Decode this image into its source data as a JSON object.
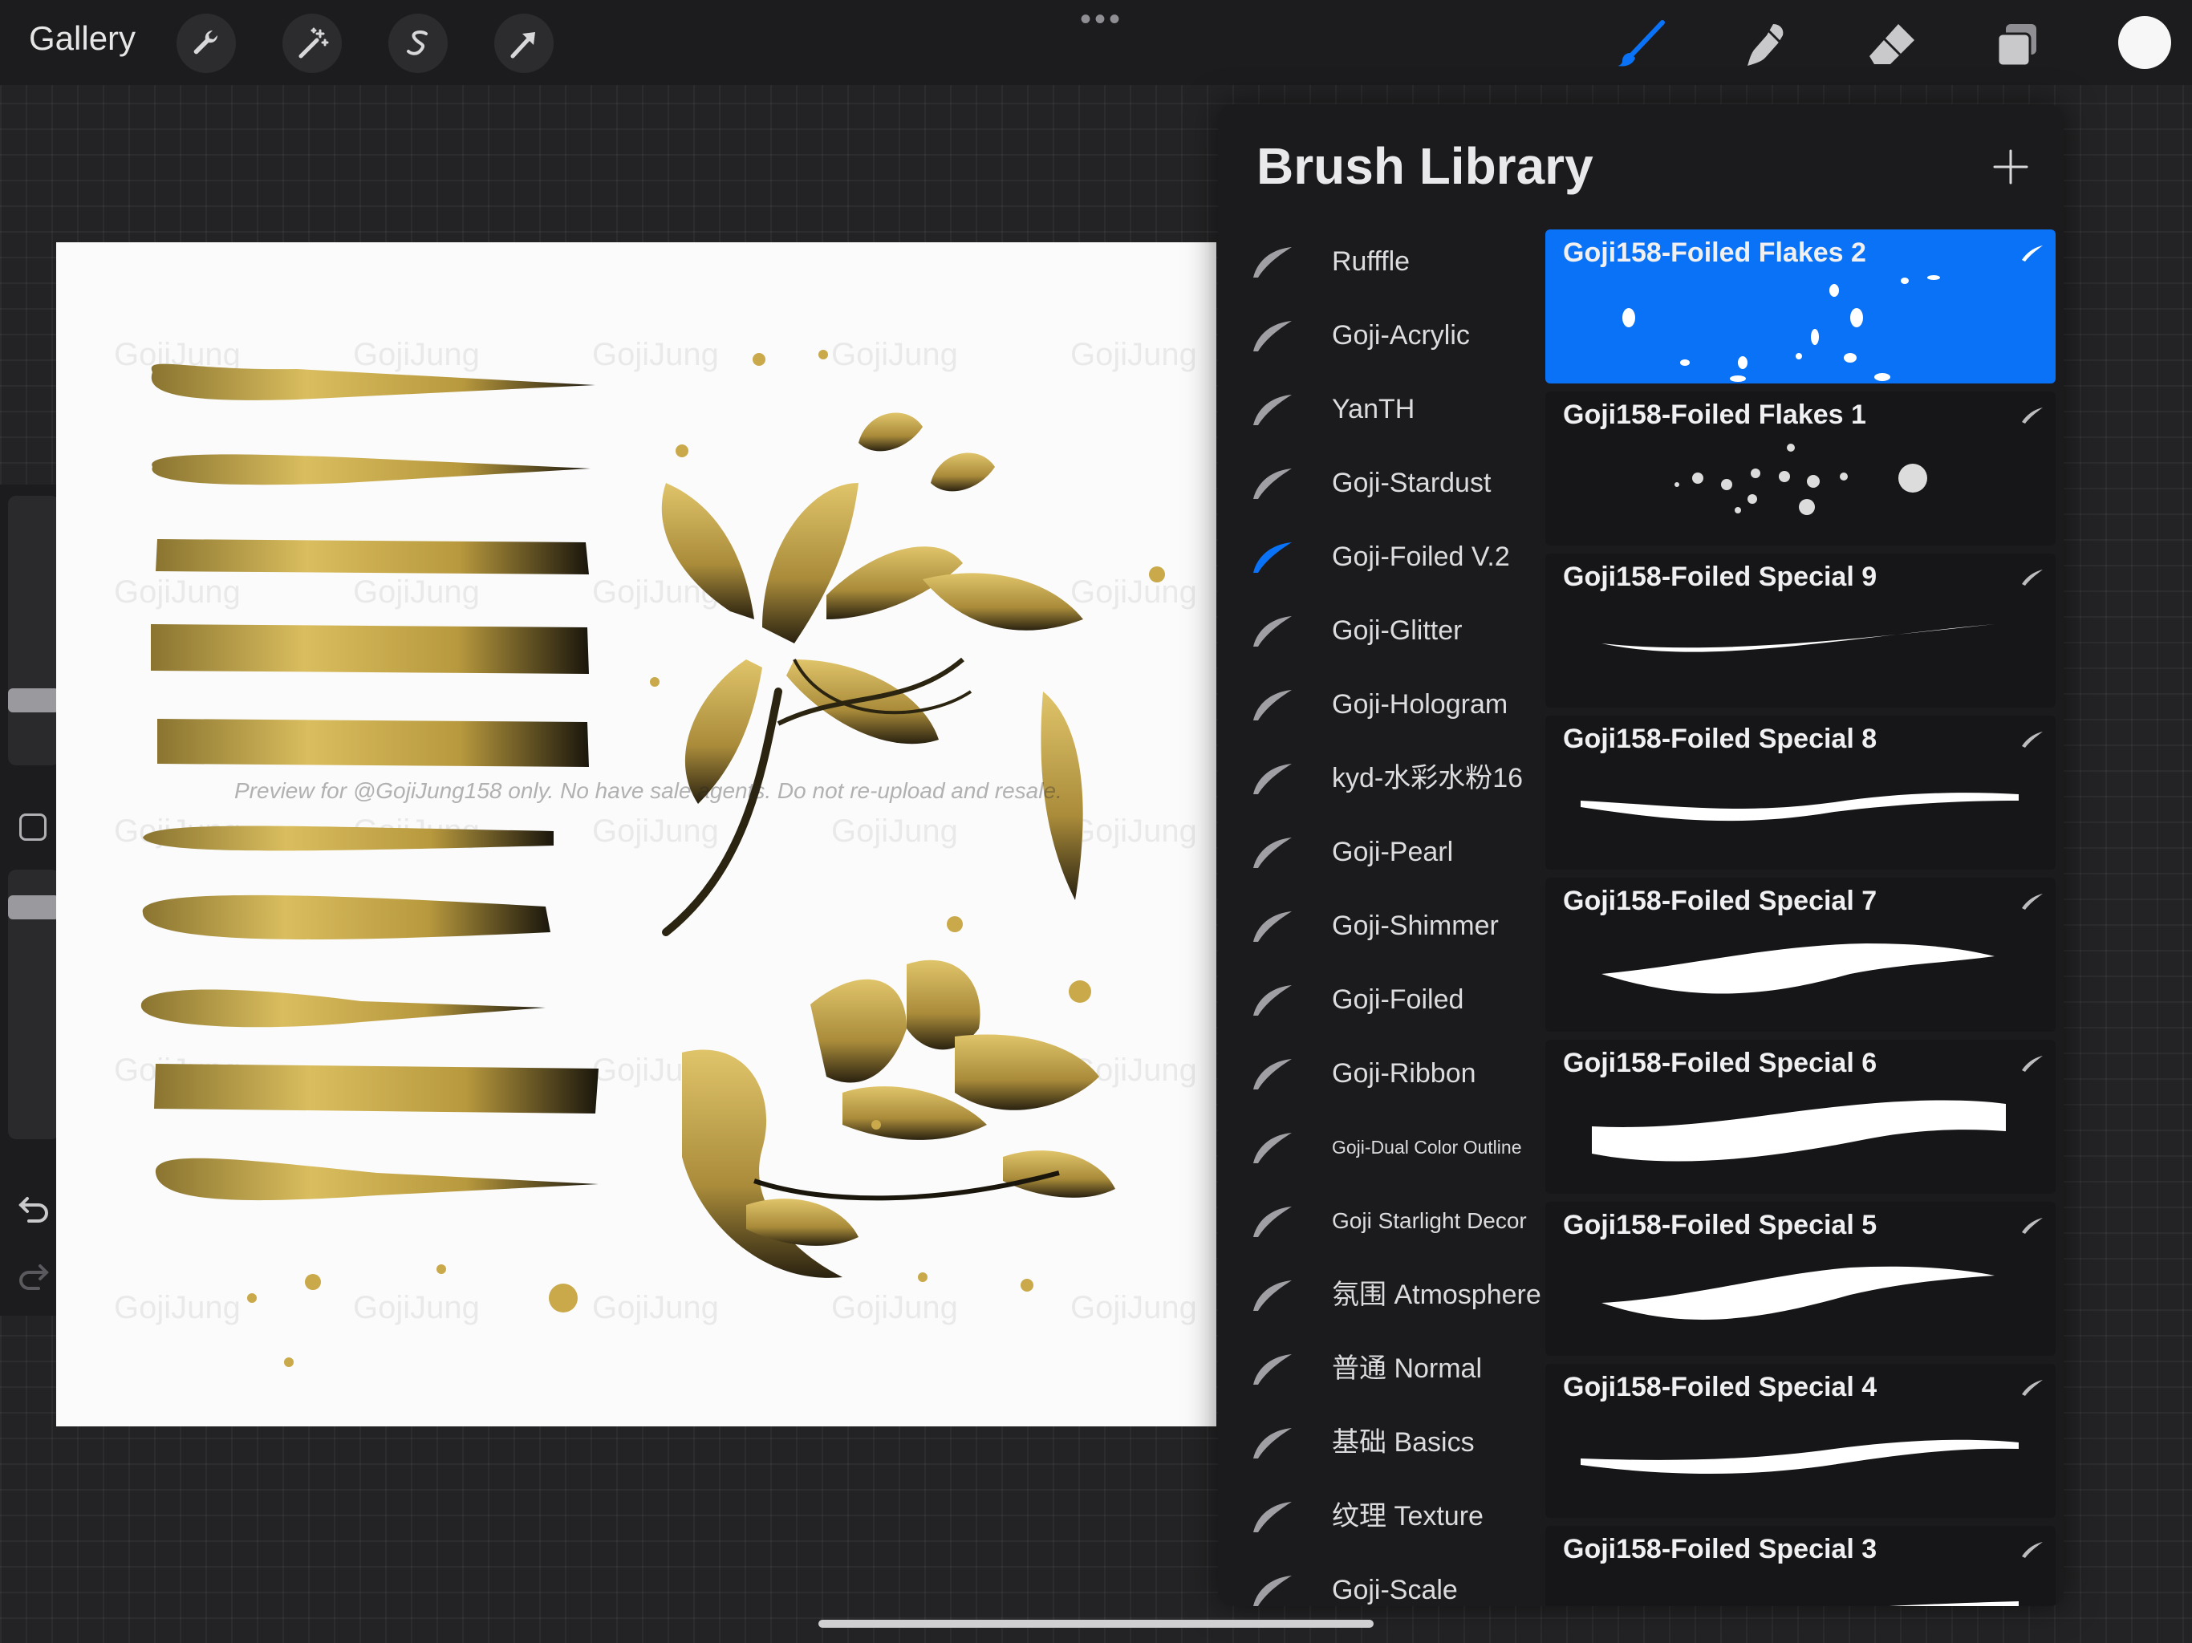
{
  "toolbar": {
    "gallery_label": "Gallery",
    "left_tools": [
      {
        "icon": "wrench-icon"
      },
      {
        "icon": "magic-wand-icon"
      },
      {
        "icon": "selection-s-icon"
      },
      {
        "icon": "transform-arrow-icon"
      }
    ],
    "more_label": "•••",
    "right_tools": [
      {
        "icon": "brush-icon",
        "active": true
      },
      {
        "icon": "smudge-icon"
      },
      {
        "icon": "eraser-icon"
      },
      {
        "icon": "layers-icon"
      }
    ],
    "current_color": "#f7f7f7",
    "accent_color": "#0a72f6"
  },
  "canvas": {
    "watermark": "GojiJung",
    "preview_note": "Preview for @GojiJung158 only. No have sale agents. Do not re-upload and resale.",
    "signature": "Goji Jung"
  },
  "library": {
    "title": "Brush Library",
    "add_icon": "plus-icon",
    "sets": [
      {
        "label": "Rufffle"
      },
      {
        "label": "Goji-Acrylic"
      },
      {
        "label": "YanTH"
      },
      {
        "label": "Goji-Stardust"
      },
      {
        "label": "Goji-Foiled V.2",
        "selected": true
      },
      {
        "label": "Goji-Glitter"
      },
      {
        "label": "Goji-Hologram"
      },
      {
        "label": "kyd-水彩水粉16"
      },
      {
        "label": "Goji-Pearl"
      },
      {
        "label": "Goji-Shimmer"
      },
      {
        "label": "Goji-Foiled"
      },
      {
        "label": "Goji-Ribbon"
      },
      {
        "label": "Goji-Dual Color Outline"
      },
      {
        "label": "Goji Starlight Decor"
      },
      {
        "label": "氛围 Atmosphere"
      },
      {
        "label": "普通 Normal"
      },
      {
        "label": "基础 Basics"
      },
      {
        "label": "纹理 Texture"
      },
      {
        "label": "Goji-Scale"
      }
    ],
    "brushes": [
      {
        "name": "Goji158-Foiled Flakes 2",
        "selected": true
      },
      {
        "name": "Goji158-Foiled Flakes 1"
      },
      {
        "name": "Goji158-Foiled Special 9"
      },
      {
        "name": "Goji158-Foiled Special 8"
      },
      {
        "name": "Goji158-Foiled Special 7"
      },
      {
        "name": "Goji158-Foiled Special 6"
      },
      {
        "name": "Goji158-Foiled Special 5"
      },
      {
        "name": "Goji158-Foiled Special 4"
      },
      {
        "name": "Goji158-Foiled Special 3"
      }
    ]
  }
}
